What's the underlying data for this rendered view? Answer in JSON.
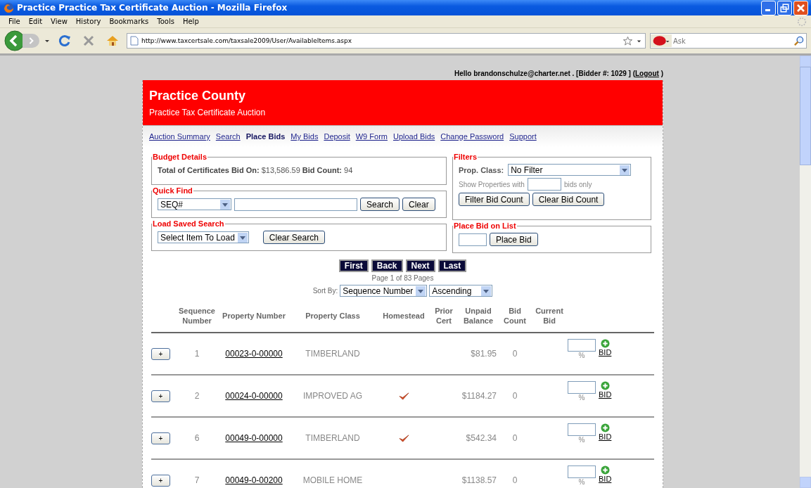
{
  "window": {
    "title": "Practice Practice Tax Certificate Auction - Mozilla Firefox",
    "menu": [
      "File",
      "Edit",
      "View",
      "History",
      "Bookmarks",
      "Tools",
      "Help"
    ],
    "url": "http://www.taxcertsale.com/taxsale2009/User/AvailableItems.aspx",
    "search_placeholder": "Ask"
  },
  "greeting": {
    "before": "Hello brandonschulze@charter.net . [Bidder #: 1029 ] (",
    "logout": "Logout",
    "after": " )"
  },
  "banner": {
    "title": "Practice County",
    "subtitle": "Practice Tax Certificate Auction"
  },
  "nav": [
    {
      "label": "Auction Summary",
      "selected": false
    },
    {
      "label": "Search",
      "selected": false
    },
    {
      "label": "Place Bids",
      "selected": true
    },
    {
      "label": "My Bids",
      "selected": false
    },
    {
      "label": "Deposit",
      "selected": false
    },
    {
      "label": "W9 Form",
      "selected": false
    },
    {
      "label": "Upload Bids",
      "selected": false
    },
    {
      "label": "Change Password",
      "selected": false
    },
    {
      "label": "Support",
      "selected": false
    }
  ],
  "budget": {
    "legend": "Budget Details",
    "text": "**Total of Certificates Bid On:** $13,586.59 **Bid Count:** 94"
  },
  "quick_find": {
    "legend": "Quick Find",
    "select": "SEQ#",
    "buttons": [
      "Search",
      "Clear"
    ]
  },
  "saved_search": {
    "legend": "Load Saved Search",
    "select": "Select Item To Load",
    "button": "Clear Search"
  },
  "filters": {
    "legend": "Filters",
    "prop_label": "Prop. Class:",
    "prop_select": "No Filter",
    "show_before": "Show Properties with",
    "show_after": "bids only",
    "buttons": [
      "Filter Bid Count",
      "Clear Bid Count"
    ]
  },
  "place_bid": {
    "legend": "Place Bid on List",
    "button": "Place Bid"
  },
  "pager": {
    "buttons": [
      "First",
      "Back",
      "Next",
      "Last"
    ],
    "info": "Page 1 of 83 Pages",
    "sort_label": "Sort By:",
    "sort_field": "Sequence Number",
    "sort_order": "Ascending"
  },
  "table": {
    "columns": [
      "Sequence Number",
      "Property Number",
      "Property Class",
      "Homestead",
      "Prior Cert",
      "Unpaid Balance",
      "Bid Count",
      "Current Bid"
    ],
    "rows": [
      {
        "expand": "+",
        "seq": "1",
        "property": "00023-0-00000",
        "class": "TIMBERLAND",
        "homestead": false,
        "balance": "$81.95",
        "count": "0",
        "percent": "%",
        "bid": "BID"
      },
      {
        "expand": "+",
        "seq": "2",
        "property": "00024-0-00000",
        "class": "IMPROVED AG",
        "homestead": true,
        "balance": "$1184.27",
        "count": "0",
        "percent": "%",
        "bid": "BID"
      },
      {
        "expand": "+",
        "seq": "6",
        "property": "00049-0-00000",
        "class": "TIMBERLAND",
        "homestead": true,
        "balance": "$542.34",
        "count": "0",
        "percent": "%",
        "bid": "BID"
      },
      {
        "expand": "+",
        "seq": "7",
        "property": "00049-0-00200",
        "class": "MOBILE HOME",
        "homestead": false,
        "balance": "$1138.57",
        "count": "0",
        "percent": "%",
        "bid": "BID"
      }
    ]
  }
}
